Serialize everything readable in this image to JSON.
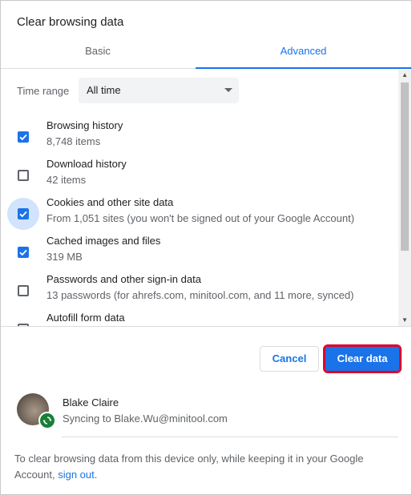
{
  "dialog": {
    "title": "Clear browsing data"
  },
  "tabs": [
    {
      "label": "Basic",
      "active": false
    },
    {
      "label": "Advanced",
      "active": true
    }
  ],
  "time_range": {
    "label": "Time range",
    "value": "All time"
  },
  "items": [
    {
      "label": "Browsing history",
      "detail": "8,748 items",
      "checked": true
    },
    {
      "label": "Download history",
      "detail": "42 items",
      "checked": false
    },
    {
      "label": "Cookies and other site data",
      "detail": "From 1,051 sites (you won't be signed out of your Google Account)",
      "checked": true
    },
    {
      "label": "Cached images and files",
      "detail": "319 MB",
      "checked": true
    },
    {
      "label": "Passwords and other sign-in data",
      "detail": "13 passwords (for ahrefs.com, minitool.com, and 11 more, synced)",
      "checked": false
    },
    {
      "label": "Autofill form data",
      "detail": "",
      "checked": false
    }
  ],
  "buttons": {
    "cancel": "Cancel",
    "clear": "Clear data"
  },
  "account": {
    "name": "Blake Claire",
    "status": "Syncing to Blake.Wu@minitool.com"
  },
  "footer": {
    "text_before": "To clear browsing data from this device only, while keeping it in your Google Account, ",
    "link": "sign out",
    "text_after": "."
  },
  "colors": {
    "accent": "#1a73e8",
    "highlight_border": "#e0002a",
    "sync_badge": "#188038"
  }
}
